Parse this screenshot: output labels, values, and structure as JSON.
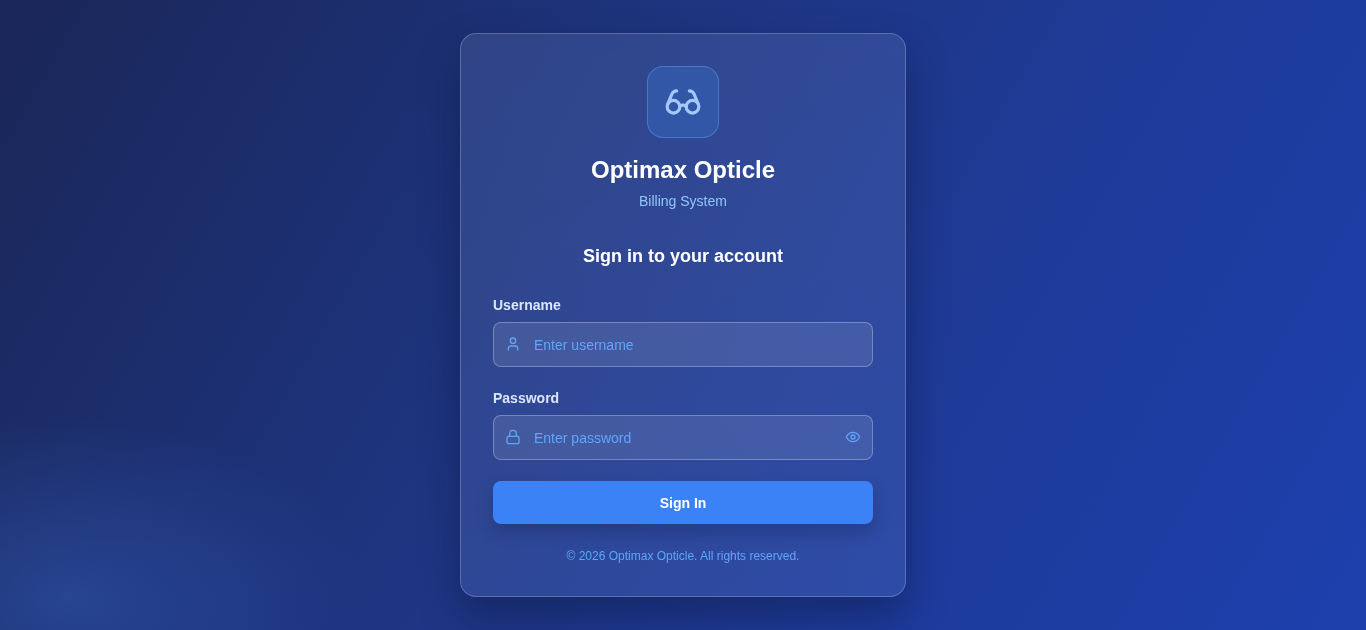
{
  "brand": {
    "name": "Optimax Opticle",
    "subtitle": "Billing System"
  },
  "heading": "Sign in to your account",
  "fields": [
    {
      "kind": "text",
      "label": "Username",
      "placeholder": "Enter username"
    },
    {
      "kind": "password",
      "label": "Password",
      "placeholder": "Enter password"
    }
  ],
  "submit": {
    "label": "Sign In"
  },
  "footer": "© 2026 Optimax Opticle. All rights reserved."
}
